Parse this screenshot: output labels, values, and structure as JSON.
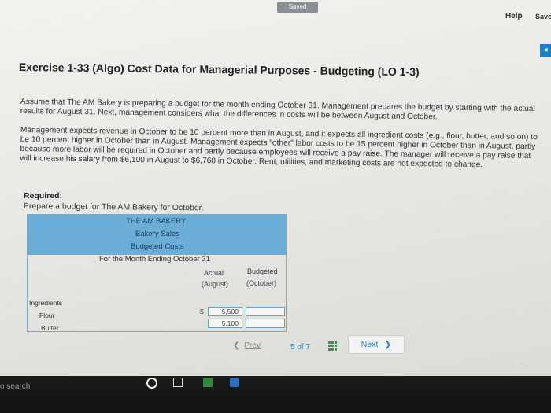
{
  "header": {
    "saved_status": "Saved",
    "help_label": "Help",
    "save_label": "Save"
  },
  "exercise": {
    "title": "Exercise 1-33 (Algo) Cost Data for Managerial Purposes - Budgeting (LO 1-3)",
    "paragraph1": "Assume that The AM Bakery is preparing a budget for the month ending October 31. Management prepares the budget by starting with the actual results for August 31. Next, management considers what the differences in costs will be between August and October.",
    "paragraph2": "Management expects revenue in October to be 10 percent more than in August, and it expects all ingredient costs (e.g., flour, butter, and so on) to be 10 percent higher in October than in August. Management expects \"other\" labor costs to be 15 percent higher in October than in August, partly because more labor will be required in October and partly because employees will receive a pay raise. The manager will receive a pay raise that will increase his salary from $6,100 in August to $6,760 in October. Rent, utilities, and marketing costs are not expected to change.",
    "required_label": "Required:",
    "required_text": "Prepare a budget for The AM Bakery for October."
  },
  "budget": {
    "company": "THE AM BAKERY",
    "line2": "Bakery Sales",
    "line3": "Budgeted Costs",
    "line4": "For the Month Ending October 31",
    "col_actual": "Actual",
    "col_actual_sub": "(August)",
    "col_budgeted": "Budgeted",
    "col_budgeted_sub": "(October)",
    "section": "Ingredients",
    "rows": [
      {
        "label": "Flour",
        "currency": "$",
        "actual": "5,500",
        "budgeted": ""
      },
      {
        "label": "Butter",
        "currency": "",
        "actual": "5,100",
        "budgeted": ""
      }
    ]
  },
  "navigation": {
    "prev_label": "Prev",
    "page_current": "5",
    "page_of": "of",
    "page_total": "7",
    "next_label": "Next"
  },
  "taskbar": {
    "search_text": "o search"
  }
}
